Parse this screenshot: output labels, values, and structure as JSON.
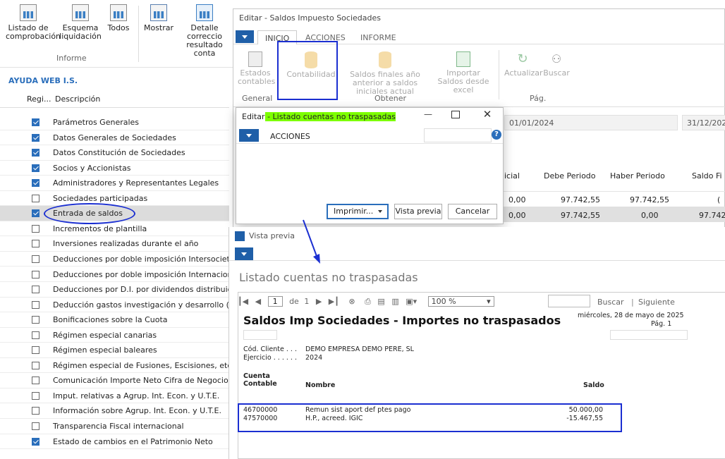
{
  "left_ribbon": {
    "buttons": [
      {
        "label": "Listado de comprobación",
        "icon": "report-icon"
      },
      {
        "label": "Esquema liquidación",
        "icon": "report-icon"
      },
      {
        "label": "Todos",
        "icon": "report-icon"
      },
      {
        "label": "Mostrar",
        "icon": "show-icon"
      },
      {
        "label": "Detalle correccio resultado conta",
        "icon": "table-icon"
      }
    ],
    "group": "Informe"
  },
  "left_panel": {
    "title": "AYUDA WEB I.S.",
    "col_reg": "Regi...",
    "col_desc": "Descripción",
    "rows": [
      {
        "label": "Parámetros Generales",
        "checked": true
      },
      {
        "label": "Datos Generales de Sociedades",
        "checked": true
      },
      {
        "label": "Datos Constitución de Sociedades",
        "checked": true
      },
      {
        "label": "Socios y Accionistas",
        "checked": true
      },
      {
        "label": "Administradores y Representantes Legales",
        "checked": true
      },
      {
        "label": "Sociedades participadas",
        "checked": false
      },
      {
        "label": "Entrada de saldos",
        "checked": true
      },
      {
        "label": "Incrementos de plantilla",
        "checked": false
      },
      {
        "label": "Inversiones realizadas durante el año",
        "checked": false
      },
      {
        "label": "Deducciones por doble imposición Intersocietaria",
        "checked": false
      },
      {
        "label": "Deducciones por doble imposición Internacional",
        "checked": false
      },
      {
        "label": "Deducciones por D.I. por dividendos distribuidos",
        "checked": false
      },
      {
        "label": "Deducción gastos investigación y desarrollo (I+D)",
        "checked": false
      },
      {
        "label": "Bonificaciones sobre la Cuota",
        "checked": false
      },
      {
        "label": "Régimen especial canarias",
        "checked": false
      },
      {
        "label": "Régimen especial baleares",
        "checked": false
      },
      {
        "label": "Régimen especial de Fusiones, Escisiones, etc.",
        "checked": false
      },
      {
        "label": "Comunicación Importe Neto Cifra de Negocios",
        "checked": false
      },
      {
        "label": "Imput. relativas a Agrup. Int. Econ. y U.T.E.",
        "checked": false
      },
      {
        "label": "Información sobre Agrup. Int. Econ. y U.T.E.",
        "checked": false
      },
      {
        "label": "Transparencia Fiscal internacional",
        "checked": false
      },
      {
        "label": "Estado de cambios en el Patrimonio Neto",
        "checked": true
      }
    ]
  },
  "editar": {
    "title": "Editar - Saldos Impuesto Sociedades",
    "tabs": [
      "INICIO",
      "ACCIONES",
      "INFORME"
    ],
    "ribbon": {
      "estados": "Estados contables",
      "contabilidad": "Contabilidad",
      "saldos_finales": "Saldos finales año anterior a saldos iniciales actual",
      "importar": "Importar Saldos desde excel",
      "actualizar": "Actualizar",
      "buscar": "Buscar",
      "g_general": "General",
      "g_obtener": "Obtener",
      "g_pag": "Pág."
    },
    "date_from": "01/01/2024",
    "date_to": "31/12/202",
    "columns": [
      "icial",
      "Debe Periodo",
      "Haber Periodo",
      "Saldo Fi"
    ],
    "rows": [
      [
        "0,00",
        "97.742,55",
        "97.742,55",
        "("
      ],
      [
        "0,00",
        "97.742,55",
        "0,00",
        "97.742"
      ]
    ]
  },
  "dialog": {
    "title_prefix": "Editar",
    "title_highlight": " - Listado cuentas no traspasadas",
    "acciones": "ACCIONES",
    "imprimir": "Imprimir...",
    "vista_previa": "Vista previa",
    "cancelar": "Cancelar"
  },
  "preview": {
    "window_title": "Vista previa",
    "heading": "Listado cuentas no traspasadas",
    "toolbar": {
      "page": "1",
      "de": "de",
      "total": "1",
      "zoom": "100 %",
      "buscar": "Buscar",
      "siguiente": "Siguiente"
    },
    "report": {
      "title": "Saldos Imp Sociedades - Importes no traspasados",
      "date": "miércoles, 28 de mayo de 2025",
      "pag": "Pág. 1",
      "cod_label": "Cód. Cliente . . .",
      "cod_value": "DEMO  EMPRESA DEMO PERE, SL",
      "ej_label": "Ejercicio . . . . . .",
      "ej_value": "2024",
      "col_cuenta": "Cuenta Contable",
      "col_nombre": "Nombre",
      "col_saldo": "Saldo",
      "rows": [
        {
          "cuenta": "46700000",
          "nombre": "Remun sist aport def ptes pago",
          "saldo": "50.000,00"
        },
        {
          "cuenta": "47570000",
          "nombre": "H.P., acreed. IGIC",
          "saldo": "-15.467,55"
        }
      ]
    }
  },
  "colors": {
    "accent": "#1f5fa8",
    "annotation": "#1b2fd1",
    "highlight": "#7dff00"
  }
}
